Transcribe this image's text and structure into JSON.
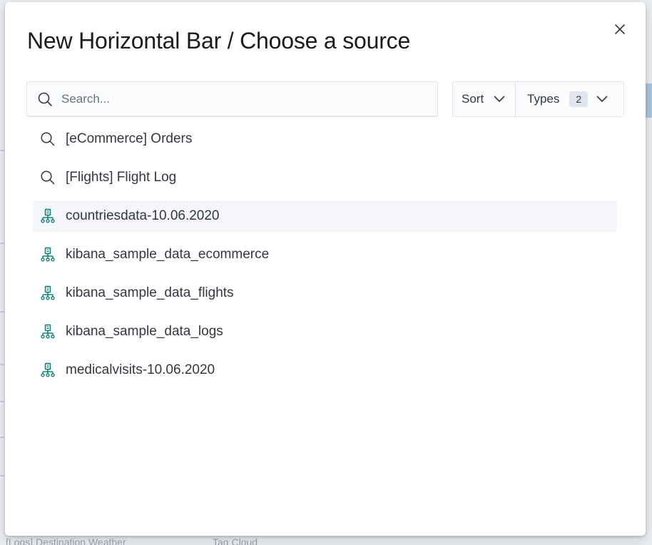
{
  "modal": {
    "title": "New Horizontal Bar / Choose a source",
    "close_icon": "close-icon"
  },
  "search": {
    "placeholder": "Search...",
    "value": "",
    "icon": "search-icon"
  },
  "filters": {
    "sort_label": "Sort",
    "types_label": "Types",
    "types_count": "2"
  },
  "results": [
    {
      "label": "[eCommerce] Orders",
      "icon": "saved-search-icon"
    },
    {
      "label": "[Flights] Flight Log",
      "icon": "saved-search-icon"
    },
    {
      "label": "countriesdata-10.06.2020",
      "icon": "index-pattern-icon"
    },
    {
      "label": "kibana_sample_data_ecommerce",
      "icon": "index-pattern-icon"
    },
    {
      "label": "kibana_sample_data_flights",
      "icon": "index-pattern-icon"
    },
    {
      "label": "kibana_sample_data_logs",
      "icon": "index-pattern-icon"
    },
    {
      "label": "medicalvisits-10.06.2020",
      "icon": "index-pattern-icon"
    }
  ],
  "background": {
    "bottom_left_text": "[Logs] Destination Weather",
    "bottom_mid_text": "Tag Cloud"
  },
  "colors": {
    "title": "#1a1c21",
    "text": "#343741",
    "index_pattern_icon": "#017d73",
    "highlight": "#f4f6f9"
  }
}
